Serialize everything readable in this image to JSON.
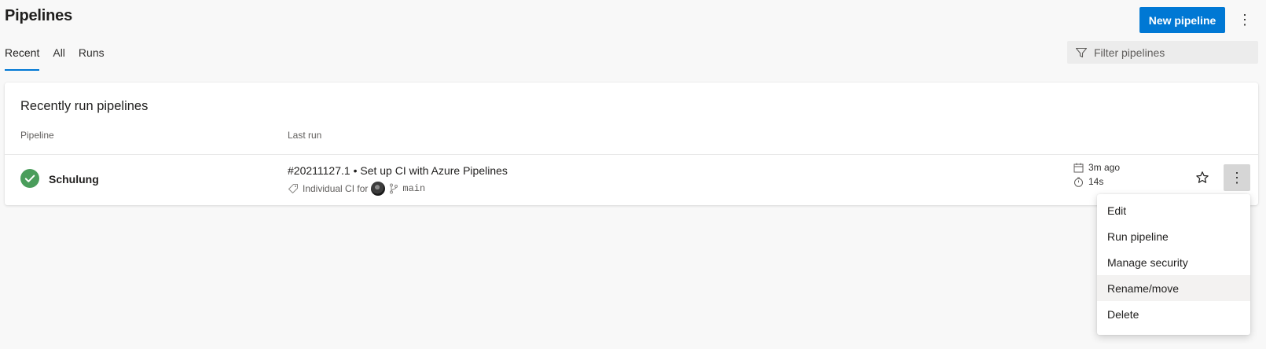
{
  "header": {
    "title": "Pipelines",
    "new_button_label": "New pipeline",
    "more_icon": "vertical-ellipsis-icon"
  },
  "tabs": [
    {
      "label": "Recent",
      "active": true
    },
    {
      "label": "All",
      "active": false
    },
    {
      "label": "Runs",
      "active": false
    }
  ],
  "filter": {
    "placeholder": "Filter pipelines",
    "value": "",
    "icon": "filter-funnel-icon"
  },
  "card": {
    "title": "Recently run pipelines",
    "columns": {
      "pipeline": "Pipeline",
      "last_run": "Last run"
    },
    "rows": [
      {
        "status": "succeeded",
        "status_icon": "check-circle-icon",
        "name": "Schulung",
        "run_title": "#20211127.1 • Set up CI with Azure Pipelines",
        "trigger_text": "Individual CI for",
        "branch": "main",
        "time_ago": "3m ago",
        "duration": "14s"
      }
    ]
  },
  "context_menu": {
    "items": [
      "Edit",
      "Run pipeline",
      "Manage security",
      "Rename/move",
      "Delete"
    ],
    "hovered_index": 3
  },
  "colors": {
    "accent": "#0078d4",
    "success": "#4a9d5b",
    "page_background": "#f8f8f8"
  }
}
